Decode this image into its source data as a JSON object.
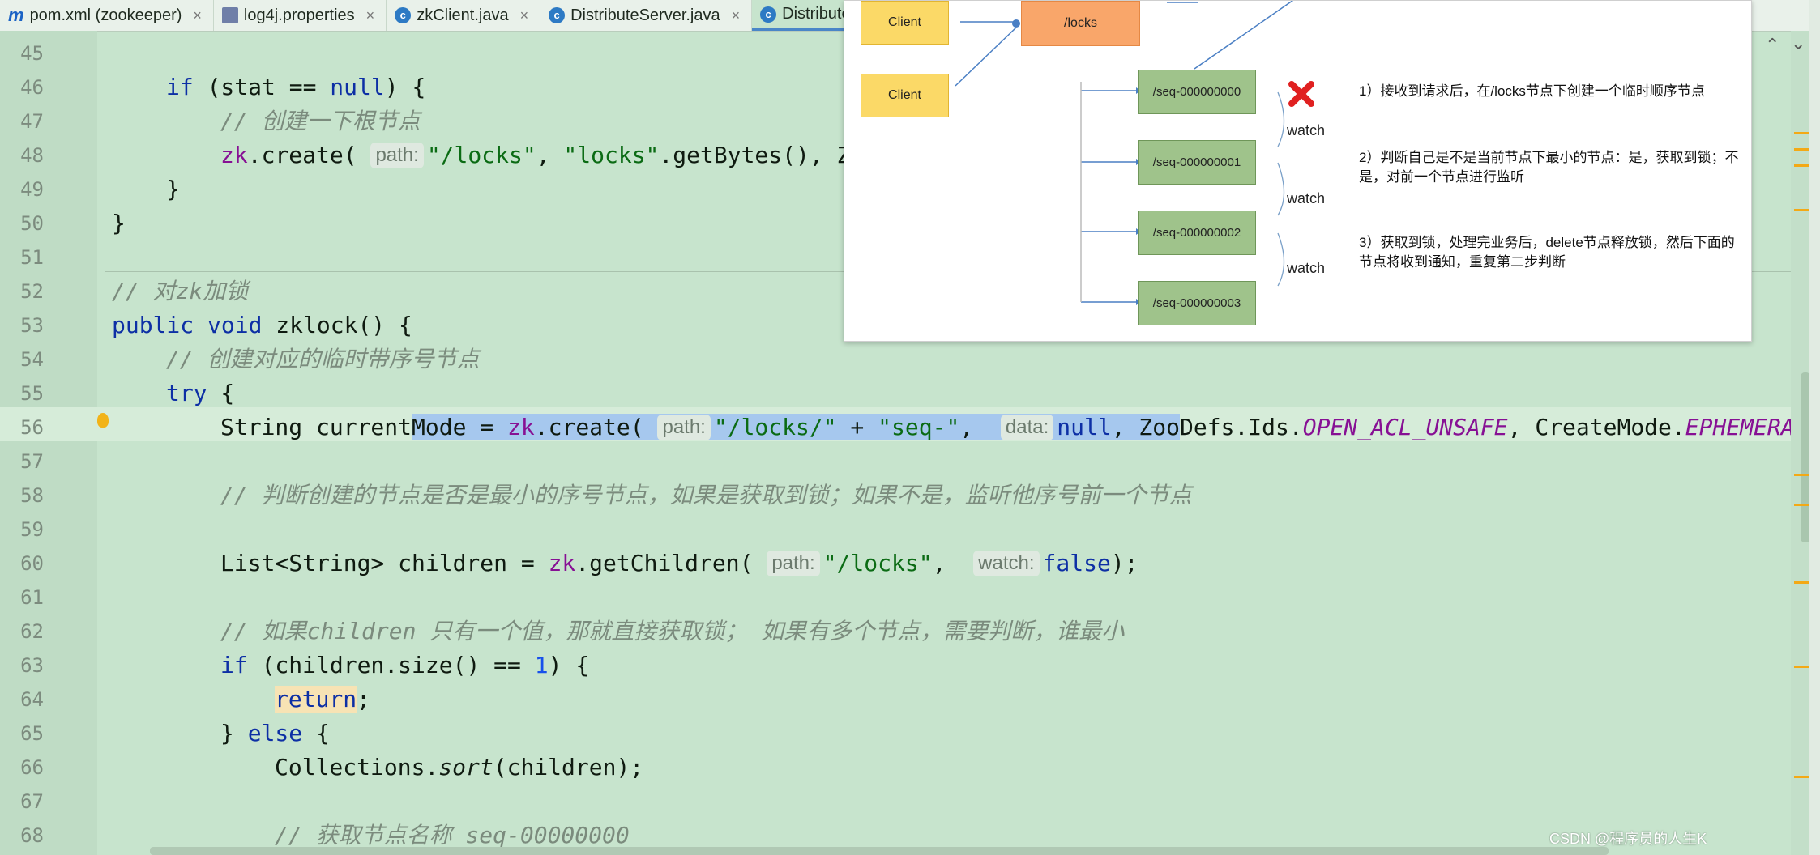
{
  "tabs": [
    {
      "icon": "maven-icon",
      "label": "pom.xml (zookeeper)"
    },
    {
      "icon": "properties-icon",
      "label": "log4j.properties"
    },
    {
      "icon": "class-icon",
      "label": "zkClient.java"
    },
    {
      "icon": "class-icon",
      "label": "DistributeServer.java"
    },
    {
      "icon": "class-icon",
      "label": "Distribute"
    }
  ],
  "code_lines": [
    {
      "n": "45",
      "text": ""
    },
    {
      "n": "46",
      "text": "if (stat == null) {"
    },
    {
      "n": "47",
      "text": "// 创建一下根节点"
    },
    {
      "n": "48",
      "text": "zk.create( path: \"/locks\", \"locks\".getBytes(), Z"
    },
    {
      "n": "49",
      "text": "}"
    },
    {
      "n": "50",
      "text": "}"
    },
    {
      "n": "51",
      "text": ""
    },
    {
      "n": "52",
      "text": "// 对zk加锁"
    },
    {
      "n": "53",
      "text": "public void zklock() {"
    },
    {
      "n": "54",
      "text": "// 创建对应的临时带序号节点"
    },
    {
      "n": "55",
      "text": "try {"
    },
    {
      "n": "56",
      "text": "String currentMode = zk.create( path: \"/locks/\" + \"seq-\",  data: null, ZooDefs.Ids.OPEN_ACL_UNSAFE, CreateMode.EPHEMERAL_"
    },
    {
      "n": "57",
      "text": ""
    },
    {
      "n": "58",
      "text": "// 判断创建的节点是否是最小的序号节点，如果是获取到锁；如果不是，监听他序号前一个节点"
    },
    {
      "n": "59",
      "text": ""
    },
    {
      "n": "60",
      "text": "List<String> children = zk.getChildren( path: \"/locks\",  watch: false);"
    },
    {
      "n": "61",
      "text": ""
    },
    {
      "n": "62",
      "text": "// 如果children 只有一个值，那就直接获取锁； 如果有多个节点，需要判断，谁最小"
    },
    {
      "n": "63",
      "text": "if (children.size() == 1) {"
    },
    {
      "n": "64",
      "text": "return;"
    },
    {
      "n": "65",
      "text": "} else {"
    },
    {
      "n": "66",
      "text": "Collections.sort(children);"
    },
    {
      "n": "67",
      "text": ""
    },
    {
      "n": "68",
      "text": "// 获取节点名称 seq-00000000"
    }
  ],
  "diagram": {
    "client1": "Client",
    "client2": "Client",
    "root": "/locks",
    "seq": [
      "/seq-000000000",
      "/seq-000000001",
      "/seq-000000002",
      "/seq-000000003"
    ],
    "watch": [
      "watch",
      "watch",
      "watch"
    ],
    "steps": [
      "1）接收到请求后，在/locks节点下创建一个临时顺序节点",
      "2）判断自己是不是当前节点下最小的节点：是，获取到锁；不是，对前一个节点进行监听",
      "3）获取到锁，处理完业务后，delete节点释放锁，然后下面的节点将收到通知，重复第二步判断"
    ]
  },
  "watermark": "CSDN @程序员的人生K"
}
